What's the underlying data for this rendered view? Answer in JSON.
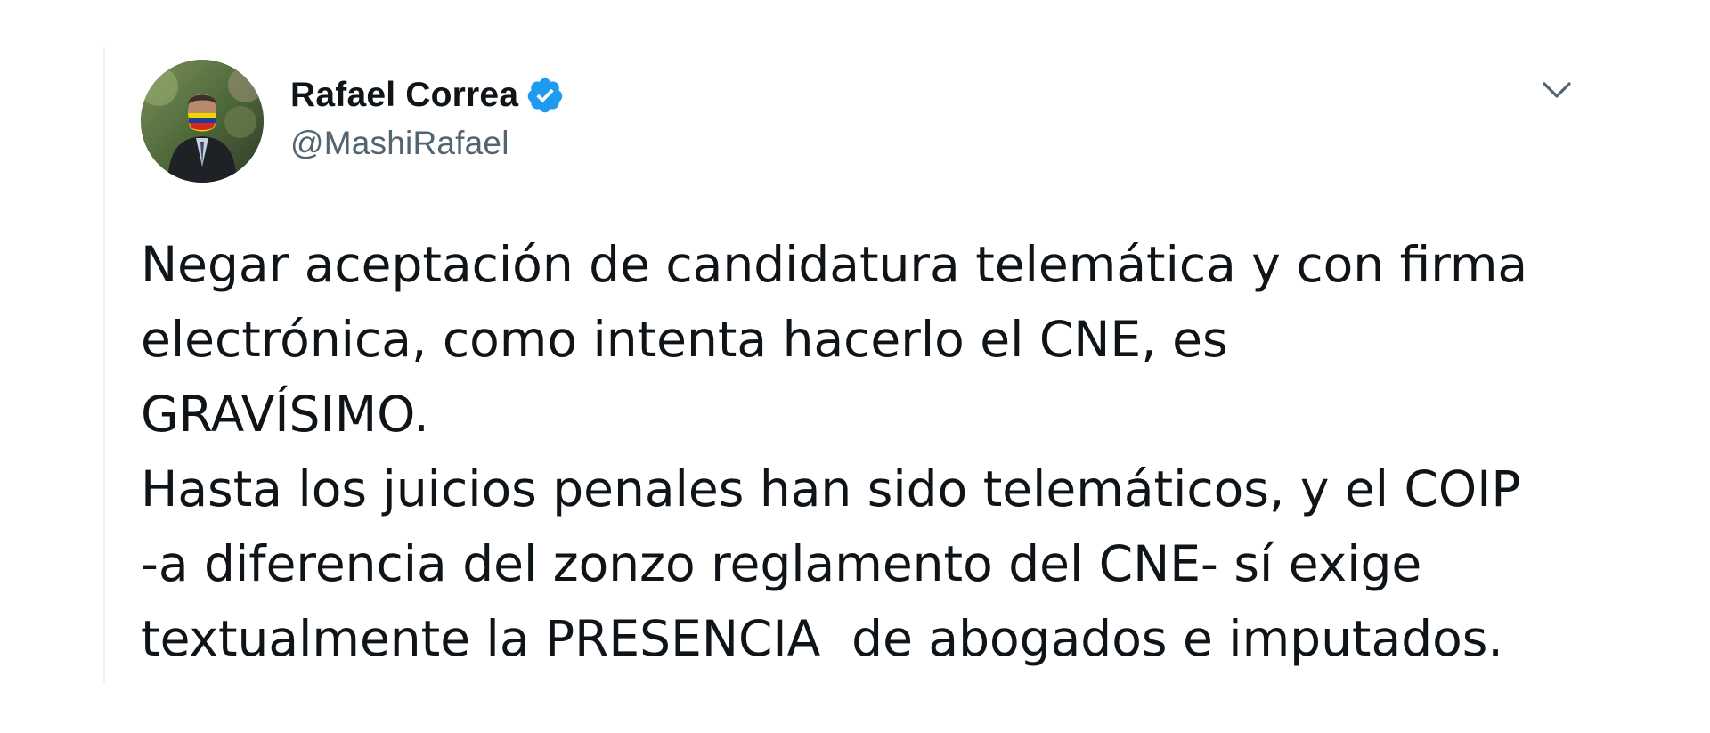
{
  "tweet": {
    "author": {
      "display_name": "Rafael Correa",
      "handle": "@MashiRafael",
      "verified": true,
      "avatar_icon": "user-avatar-photo"
    },
    "menu_icon": "chevron-down-icon",
    "text_lines": [
      "Negar aceptación de candidatura telemática y con firma",
      "electrónica, como intenta hacerlo el CNE, es",
      "GRAVÍSIMO.",
      "Hasta los juicios penales han sido telemáticos, y el COIP",
      "-a diferencia del zonzo reglamento del CNE- sí exige",
      "textualmente la PRESENCIA  de abogados e imputados."
    ]
  },
  "colors": {
    "text": "#0f1419",
    "secondary_text": "#536471",
    "verified_badge": "#1d9bf0",
    "chevron": "#536471",
    "background": "#ffffff"
  }
}
